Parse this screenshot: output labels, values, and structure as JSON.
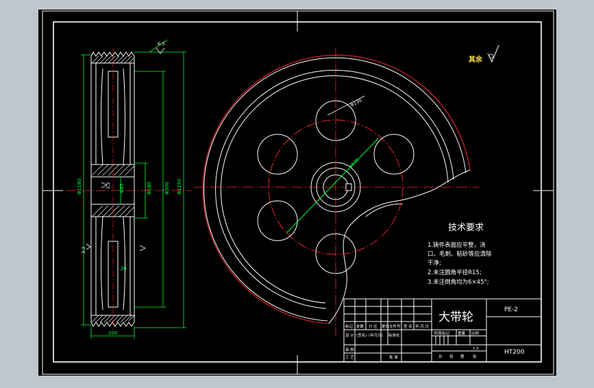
{
  "colors": {
    "window_bg": "#c0c6cd",
    "sheet_bg": "#000000",
    "line_white": "#ffffff",
    "line_red": "#ff2a2a",
    "line_green": "#00ff3c"
  },
  "drawing": {
    "title": "大带轮",
    "drawing_number": "PE-2",
    "material": "HT200",
    "scale": "1:5",
    "surface_finish_symbol": "6.3",
    "surface_finish_rest": "其余",
    "tech_requirements": {
      "heading": "技术要求",
      "line1": "1.铸件表面应平整，浇",
      "line2": "口、毛刺、粘砂等应清除",
      "line3": "干净;",
      "line4": "2.未注圆角半径R15;",
      "line5": "3.未注倒角均为6×45°;"
    },
    "title_block": {
      "row1": [
        "标记",
        "处数",
        "分 区",
        "更改文件号",
        "签 名",
        "年.月.日"
      ],
      "row2": [
        "设 计",
        "(签名)",
        "(年月日)",
        "标准化"
      ],
      "row2_right": [
        "阶段标记",
        "重量",
        "比例"
      ],
      "row3_left": "审 核",
      "row4_left": [
        "工 艺",
        "批 准"
      ],
      "row4_right": [
        "共",
        "张",
        "第",
        "张"
      ]
    },
    "dimensions": {
      "d_hole": "Φ130",
      "d_pcd": "Φ540",
      "left_outer": "Φ1190",
      "left_hub": "Φ85",
      "left_mid": "Φ180",
      "left_rim": "Φ300",
      "right_outer": "Φ1250",
      "width": "200",
      "key": "26",
      "rough_a": "3.2",
      "rough_b": "6.3",
      "rough_c": "3.2"
    }
  }
}
